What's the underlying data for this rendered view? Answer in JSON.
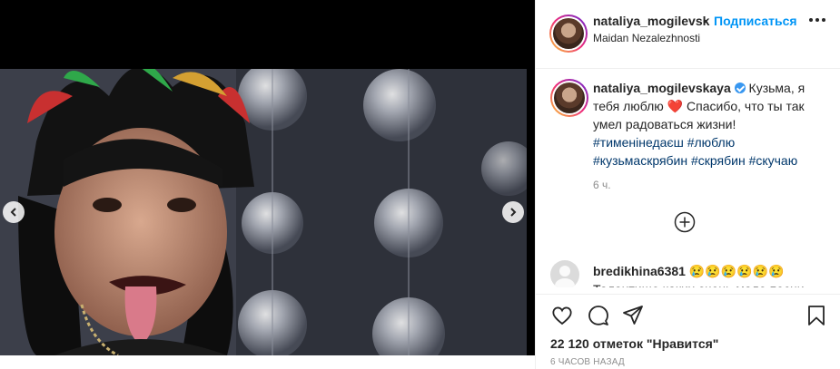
{
  "post": {
    "username": "nataliya_mogilevsk",
    "separator": "•",
    "follow_label": "Подписаться",
    "location": "Maidan Nezalezhnosti"
  },
  "caption": {
    "username": "nataliya_mogilevskaya",
    "text_line1": " Кузьма, я тебя люблю ",
    "heart": "❤️",
    "text_line2": " Спасибо, что ты так умел радоваться жизни!",
    "hashtags": "#тименінедаєш #люблю #кузьмаскрябин #скрябин #скучаю",
    "time": "6 ч."
  },
  "comments": [
    {
      "username": "bredikhina6381",
      "text": "😢😢😢😢😢😢 Талантище каких очень мало песни"
    }
  ],
  "likes": {
    "count": "22 120",
    "suffix": " отметок \"Нравится\""
  },
  "posted_ago": "6 часов назад",
  "icons": {
    "like": "heart-outline-icon",
    "comment": "comment-icon",
    "share": "paper-plane-icon",
    "save": "bookmark-icon",
    "load_more": "plus-circle-icon",
    "prev": "chevron-left-icon",
    "next": "chevron-right-icon"
  },
  "colors": {
    "accent": "#0095f6",
    "verified": "#3897f0",
    "heart": "#ed4956",
    "hashtag": "#00376b"
  }
}
